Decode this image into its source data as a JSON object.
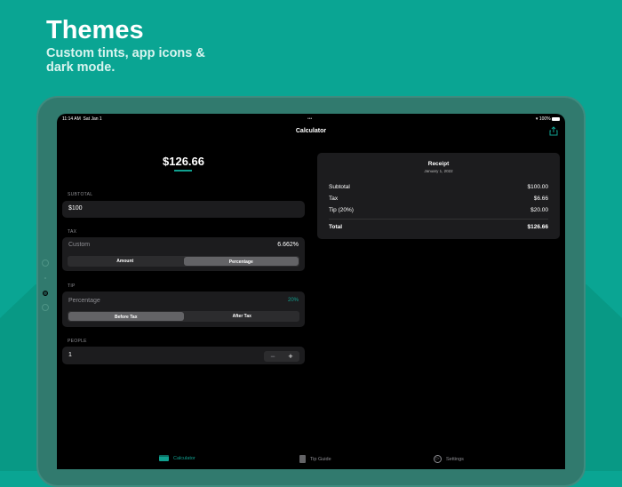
{
  "hero": {
    "title": "Themes",
    "subtitle": "Custom tints, app icons & dark mode."
  },
  "status": {
    "time": "11:14 AM",
    "date": "Sat Jan 1",
    "battery": "100%"
  },
  "nav": {
    "title": "Calculator",
    "share_icon": "share-icon"
  },
  "total": "$126.66",
  "subtotal": {
    "label": "SUBTOTAL",
    "value": "$100"
  },
  "tax": {
    "label": "TAX",
    "mode": "Custom",
    "value": "6.662%",
    "segments": [
      "Amount",
      "Percentage"
    ],
    "selected": "Percentage"
  },
  "tip": {
    "label": "TIP",
    "mode": "Percentage",
    "value": "20%",
    "segments": [
      "Before Tax",
      "After Tax"
    ],
    "selected": "Before Tax"
  },
  "people": {
    "label": "PEOPLE",
    "value": "1",
    "minus": "−",
    "plus": "+"
  },
  "receipt": {
    "title": "Receipt",
    "date": "January 1, 2022",
    "rows": [
      {
        "label": "Subtotal",
        "value": "$100.00"
      },
      {
        "label": "Tax",
        "value": "$6.66"
      },
      {
        "label": "Tip (20%)",
        "value": "$20.00"
      }
    ],
    "total": {
      "label": "Total",
      "value": "$126.66"
    }
  },
  "tabs": [
    {
      "label": "Calculator",
      "active": true
    },
    {
      "label": "Tip Guide"
    },
    {
      "label": "Settings"
    }
  ],
  "colors": {
    "accent": "#10a08f",
    "background": "#0aa593"
  }
}
